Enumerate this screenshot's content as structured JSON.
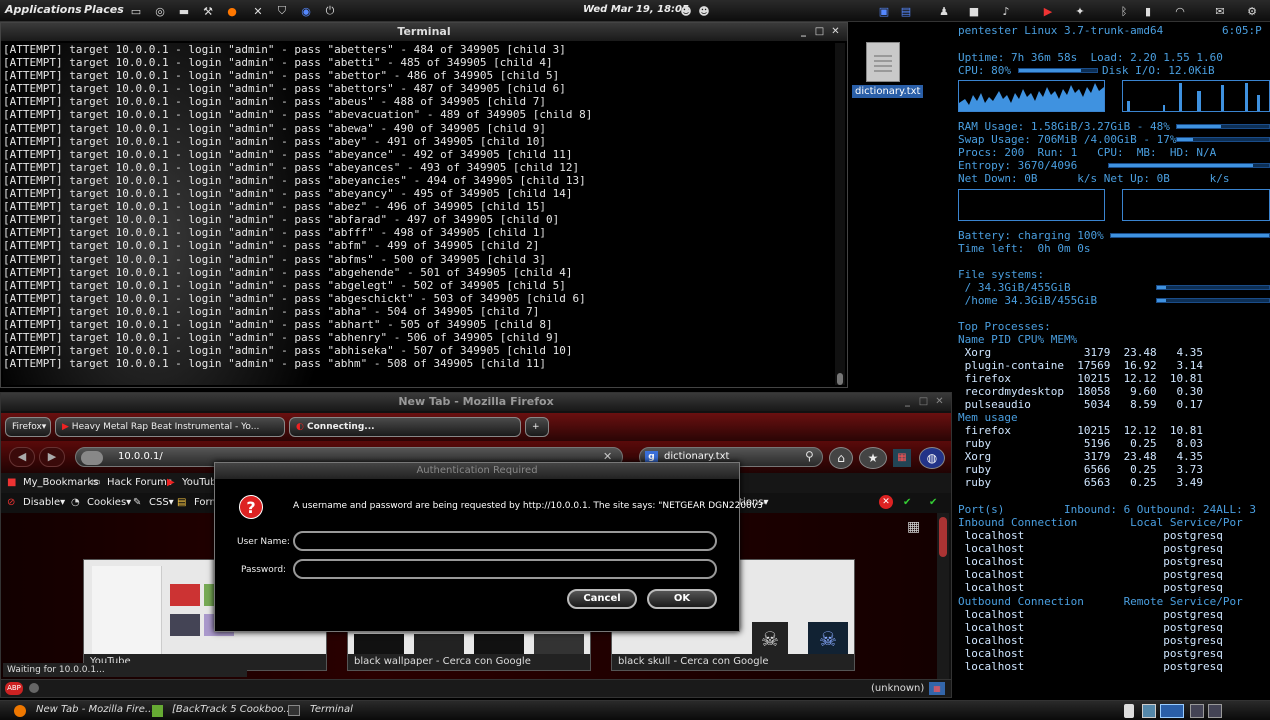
{
  "top_panel": {
    "menus": [
      "Applications",
      "Places"
    ],
    "clock": "Wed Mar 19, 18:05",
    "tray_icons": [
      "window-icon",
      "chrome-icon",
      "desktop-icon",
      "wrench-icon",
      "firefox-icon",
      "x-icon",
      "shield-icon",
      "lock-icon",
      "power-icon"
    ]
  },
  "terminal": {
    "title": "Terminal",
    "lines": [
      "[ATTEMPT] target 10.0.0.1 - login \"admin\" - pass \"abetters\" - 484 of 349905 [child 3]",
      "[ATTEMPT] target 10.0.0.1 - login \"admin\" - pass \"abetti\" - 485 of 349905 [child 4]",
      "[ATTEMPT] target 10.0.0.1 - login \"admin\" - pass \"abettor\" - 486 of 349905 [child 5]",
      "[ATTEMPT] target 10.0.0.1 - login \"admin\" - pass \"abettors\" - 487 of 349905 [child 6]",
      "[ATTEMPT] target 10.0.0.1 - login \"admin\" - pass \"abeus\" - 488 of 349905 [child 7]",
      "[ATTEMPT] target 10.0.0.1 - login \"admin\" - pass \"abevacuation\" - 489 of 349905 [child 8]",
      "[ATTEMPT] target 10.0.0.1 - login \"admin\" - pass \"abewa\" - 490 of 349905 [child 9]",
      "[ATTEMPT] target 10.0.0.1 - login \"admin\" - pass \"abey\" - 491 of 349905 [child 10]",
      "[ATTEMPT] target 10.0.0.1 - login \"admin\" - pass \"abeyance\" - 492 of 349905 [child 11]",
      "[ATTEMPT] target 10.0.0.1 - login \"admin\" - pass \"abeyances\" - 493 of 349905 [child 12]",
      "[ATTEMPT] target 10.0.0.1 - login \"admin\" - pass \"abeyancies\" - 494 of 349905 [child 13]",
      "[ATTEMPT] target 10.0.0.1 - login \"admin\" - pass \"abeyancy\" - 495 of 349905 [child 14]",
      "[ATTEMPT] target 10.0.0.1 - login \"admin\" - pass \"abez\" - 496 of 349905 [child 15]",
      "[ATTEMPT] target 10.0.0.1 - login \"admin\" - pass \"abfarad\" - 497 of 349905 [child 0]",
      "[ATTEMPT] target 10.0.0.1 - login \"admin\" - pass \"abfff\" - 498 of 349905 [child 1]",
      "[ATTEMPT] target 10.0.0.1 - login \"admin\" - pass \"abfm\" - 499 of 349905 [child 2]",
      "[ATTEMPT] target 10.0.0.1 - login \"admin\" - pass \"abfms\" - 500 of 349905 [child 3]",
      "[ATTEMPT] target 10.0.0.1 - login \"admin\" - pass \"abgehende\" - 501 of 349905 [child 4]",
      "[ATTEMPT] target 10.0.0.1 - login \"admin\" - pass \"abgelegt\" - 502 of 349905 [child 5]",
      "[ATTEMPT] target 10.0.0.1 - login \"admin\" - pass \"abgeschickt\" - 503 of 349905 [child 6]",
      "[ATTEMPT] target 10.0.0.1 - login \"admin\" - pass \"abha\" - 504 of 349905 [child 7]",
      "[ATTEMPT] target 10.0.0.1 - login \"admin\" - pass \"abhart\" - 505 of 349905 [child 8]",
      "[ATTEMPT] target 10.0.0.1 - login \"admin\" - pass \"abhenry\" - 506 of 349905 [child 9]",
      "[ATTEMPT] target 10.0.0.1 - login \"admin\" - pass \"abhiseka\" - 507 of 349905 [child 10]",
      "[ATTEMPT] target 10.0.0.1 - login \"admin\" - pass \"abhm\" - 508 of 349905 [child 11]"
    ]
  },
  "desktop": {
    "file_label": "dictionary.txt"
  },
  "conky": {
    "host": "pentester Linux 3.7-trunk-amd64",
    "time": "6:05:P",
    "uptime": "Uptime: 7h 36m 58s  Load: 2.20 1.55 1.60",
    "cpu": "CPU: 80%",
    "cpu_fraction": 0.8,
    "disk_io": "Disk I/O: 12.0KiB",
    "ram": "RAM Usage: 1.58GiB/3.27GiB - 48%",
    "ram_fraction": 0.48,
    "swap": "Swap Usage: 706MiB /4.00GiB - 17%",
    "swap_fraction": 0.17,
    "procs": "Procs: 200  Run: 1   CPU:  MB:  HD: N/A",
    "entropy": "Entropy: 3670/4096",
    "entropy_fraction": 0.9,
    "net": "Net Down: 0B      k/s Net Up: 0B      k/s",
    "battery": "Battery: charging 100%",
    "battery_fraction": 1.0,
    "time_left": "Time left:  0h 0m 0s",
    "fs_title": "File systems:",
    "fs_root": " / 34.3GiB/455GiB",
    "fs_home": " /home 34.3GiB/455GiB",
    "top_title": "Top Processes:",
    "top_header": "Name PID CPU% MEM%",
    "top_rows": [
      " Xorg              3179  23.48   4.35",
      " plugin-containe  17569  16.92   3.14",
      " firefox          10215  12.12  10.81",
      " recordmydesktop  18058   9.60   0.30",
      " pulseaudio        5034   8.59   0.17"
    ],
    "mem_title": "Mem usage",
    "mem_rows": [
      " firefox          10215  12.12  10.81",
      " ruby              5196   0.25   8.03",
      " Xorg              3179  23.48   4.35",
      " ruby              6566   0.25   3.73",
      " ruby              6563   0.25   3.49"
    ],
    "ports": "Port(s)         Inbound: 6 Outbound: 24ALL: 3",
    "inbound_header": "Inbound Connection        Local Service/Por",
    "inbound_rows": [
      " localhost                     postgresq",
      " localhost                     postgresq",
      " localhost                     postgresq",
      " localhost                     postgresq",
      " localhost                     postgresq"
    ],
    "outbound_header": "Outbound Connection      Remote Service/Por",
    "outbound_rows": [
      " localhost                     postgresq",
      " localhost                     postgresq",
      " localhost                     postgresq",
      " localhost                     postgresq",
      " localhost                     postgresq"
    ]
  },
  "firefox": {
    "title": "New Tab - Mozilla Firefox",
    "menu_button": "Firefox",
    "tabs": [
      "Heavy Metal Rap Beat Instrumental - Yo...",
      "Connecting..."
    ],
    "url": "10.0.0.1/",
    "search": "dictionary.txt",
    "bookmarks": [
      "My_Bookmarks",
      "Hack Forums",
      "YouTube"
    ],
    "devbar": [
      "Disable▾",
      "Cookies▾",
      "CSS▾",
      "Form",
      "ations▾"
    ],
    "thumbnails": [
      "YouTube",
      "black wallpaper - Cerca con Google",
      "black skull - Cerca con Google"
    ],
    "status": "Waiting for 10.0.0.1...",
    "addon_status": "(unknown)"
  },
  "auth_dialog": {
    "title": "Authentication Required",
    "message": "A username and password are being requested by http://10.0.0.1. The site says: \"NETGEAR DGN2200v3\"",
    "username_label": "User Name:",
    "password_label": "Password:",
    "username_value": "",
    "password_value": "",
    "cancel_label": "Cancel",
    "ok_label": "OK"
  },
  "taskbar": {
    "tasks": [
      "New Tab - Mozilla Fire...",
      "[BackTrack 5 Cookboo...",
      "Terminal"
    ]
  },
  "colors": {
    "conky_text": "#4a9fe0",
    "firefox_red": "#6a1010"
  }
}
